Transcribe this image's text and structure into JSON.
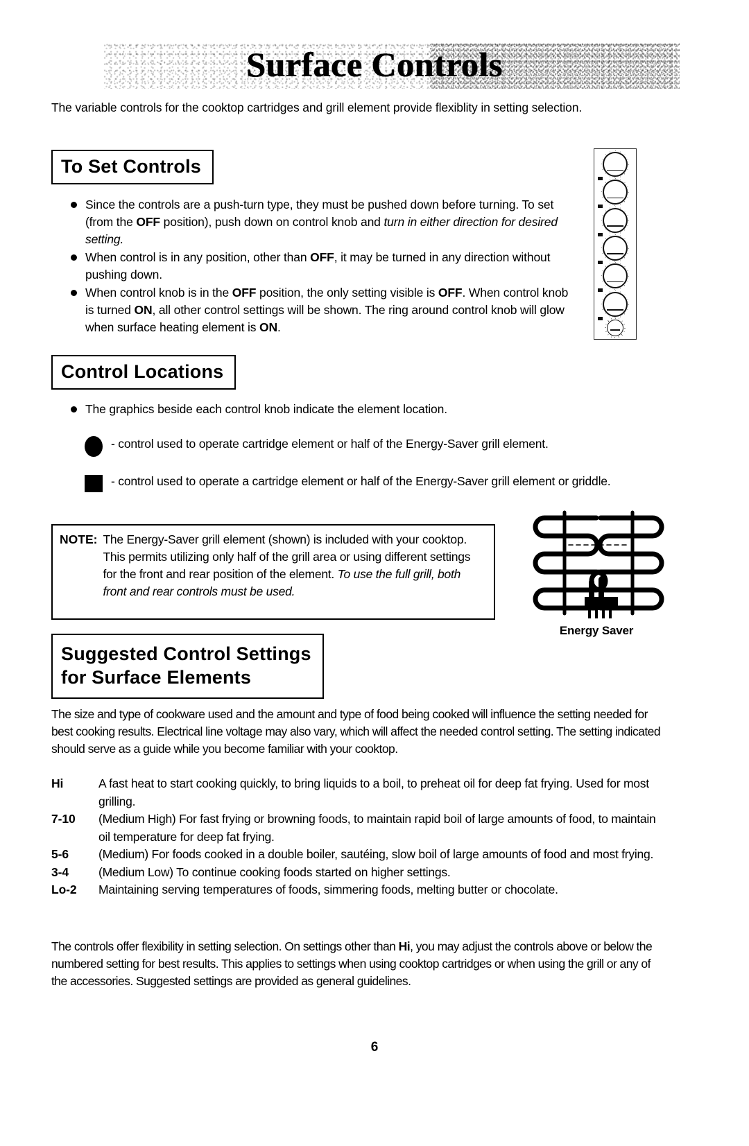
{
  "document": {
    "title": "Surface Controls",
    "page_number": "6",
    "intro": "The variable controls for the cooktop cartridges and grill element provide flexiblity in setting selection."
  },
  "to_set_controls": {
    "heading": "To Set Controls",
    "bullets": [
      {
        "segments": [
          {
            "text": "Since the controls are a push-turn type, they must be pushed down before turning.  To set (from the ",
            "style": "normal"
          },
          {
            "text": "OFF",
            "style": "bold"
          },
          {
            "text": " position), push down on control knob and ",
            "style": "normal"
          },
          {
            "text": "turn in either direction for desired setting.",
            "style": "italic"
          }
        ]
      },
      {
        "segments": [
          {
            "text": "When control is in any position, other than ",
            "style": "normal"
          },
          {
            "text": "OFF",
            "style": "bold"
          },
          {
            "text": ", it may be turned in any direction without pushing down.",
            "style": "normal"
          }
        ]
      },
      {
        "segments": [
          {
            "text": "When control knob is in the ",
            "style": "normal"
          },
          {
            "text": "OFF",
            "style": "bold"
          },
          {
            "text": " position, the only setting visible is ",
            "style": "normal"
          },
          {
            "text": "OFF",
            "style": "bold"
          },
          {
            "text": ". When control knob is turned ",
            "style": "normal"
          },
          {
            "text": "ON",
            "style": "bold"
          },
          {
            "text": ", all other control settings will be shown. The ring around control knob will glow when surface heating element is ",
            "style": "normal"
          },
          {
            "text": "ON",
            "style": "bold"
          },
          {
            "text": ".",
            "style": "normal"
          }
        ]
      }
    ]
  },
  "control_panel_graphic": {
    "name": "control-panel-illustration",
    "knob_count": 6,
    "small_knob_count": 1
  },
  "control_locations": {
    "heading": "Control Locations",
    "bullet": "The graphics beside each control knob indicate the element location.",
    "legend": [
      {
        "glyph": "filled-circle",
        "text": "- control used to operate cartridge element or half of the Energy-Saver grill element."
      },
      {
        "glyph": "filled-square",
        "text": "- control used to operate a cartridge element or half of the Energy-Saver grill element or griddle."
      }
    ]
  },
  "note": {
    "label": "NOTE:",
    "segments": [
      {
        "text": "The Energy-Saver grill element (shown) is included with your cooktop. This permits utilizing only half of the grill area or using different settings for the front and rear position of the element.  ",
        "style": "normal"
      },
      {
        "text": "To use the full grill, both front and rear controls must be used.",
        "style": "italic"
      }
    ]
  },
  "energy_saver": {
    "caption": "Energy Saver"
  },
  "suggested_settings": {
    "heading_line1": "Suggested Control Settings",
    "heading_line2": "for Surface Elements",
    "intro": "The size and type of cookware used and the amount and type of food being cooked will influence the setting needed for best cooking results. Electrical line voltage may also vary, which will affect the needed control setting.  The setting indicated should serve as a guide while you become familiar with your cooktop.",
    "rows": [
      {
        "term": "Hi",
        "definition": "A fast heat to start cooking quickly, to bring liquids to a boil, to preheat oil for deep fat frying.  Used for most grilling."
      },
      {
        "term": "7-10",
        "definition": "(Medium High) For fast frying or browning foods, to maintain rapid boil of large amounts of food, to maintain oil temperature for deep fat frying."
      },
      {
        "term": "5-6",
        "definition": "(Medium) For foods cooked in a double boiler, sautéing, slow boil of large amounts of food and most frying."
      },
      {
        "term": "3-4",
        "definition": "(Medium Low) To continue cooking foods started on higher settings."
      },
      {
        "term": "Lo-2",
        "definition": "Maintaining serving temperatures of foods, simmering foods, melting butter or chocolate."
      }
    ],
    "closing": {
      "segments": [
        {
          "text": "The controls offer flexibility in setting selection.  On settings other than ",
          "style": "normal"
        },
        {
          "text": "Hi",
          "style": "bold"
        },
        {
          "text": ", you may adjust the controls above or below the numbered setting for best results.  This applies to settings when using cooktop cartridges or when using the grill or any of the accessories. Suggested settings are provided as general guidelines.",
          "style": "normal"
        }
      ]
    }
  }
}
